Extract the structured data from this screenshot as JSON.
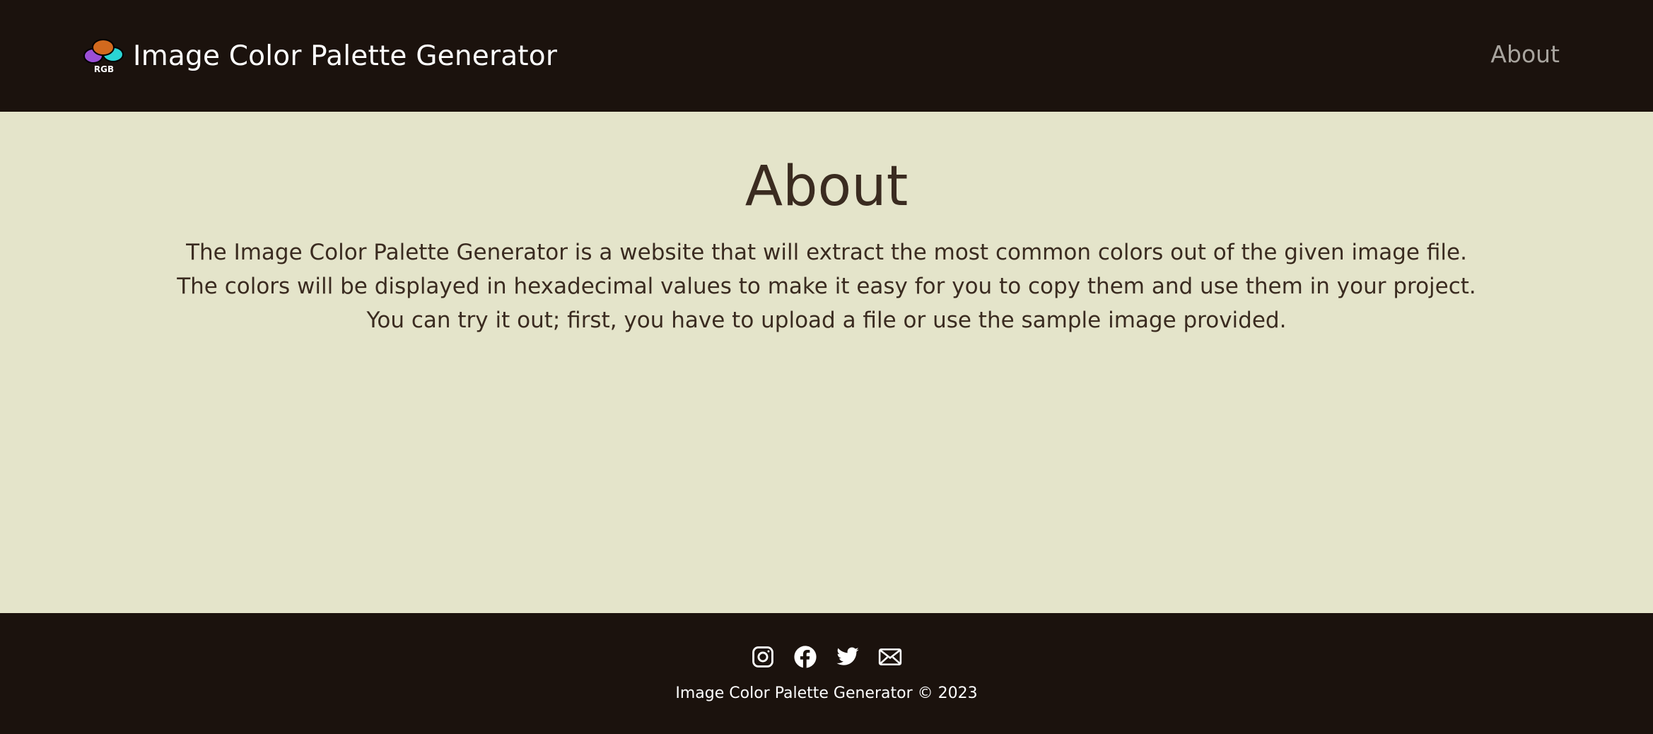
{
  "navbar": {
    "brand_title": "Image Color Palette Generator",
    "logo_text": "RGB",
    "about_link": "About"
  },
  "main": {
    "heading": "About",
    "paragraph_lines": [
      "The Image Color Palette Generator is a website that will extract the most common colors out of the given image file.",
      "The colors will be displayed in hexadecimal values to make it easy for you to copy them and use them in your project.",
      "You can try it out; first, you have to upload a file or use the sample image provided."
    ]
  },
  "footer": {
    "social_icons": [
      "instagram-icon",
      "facebook-icon",
      "twitter-icon",
      "mail-icon"
    ],
    "copyright": "Image Color Palette Generator © 2023"
  },
  "colors": {
    "header_footer_bg": "#1b120d",
    "page_bg": "#e4e4ca",
    "text_dark": "#3a2b20",
    "nav_link": "#a8a49e",
    "logo_orange": "#d2691e",
    "logo_purple": "#9b4fd6",
    "logo_cyan": "#2ad4d4"
  }
}
